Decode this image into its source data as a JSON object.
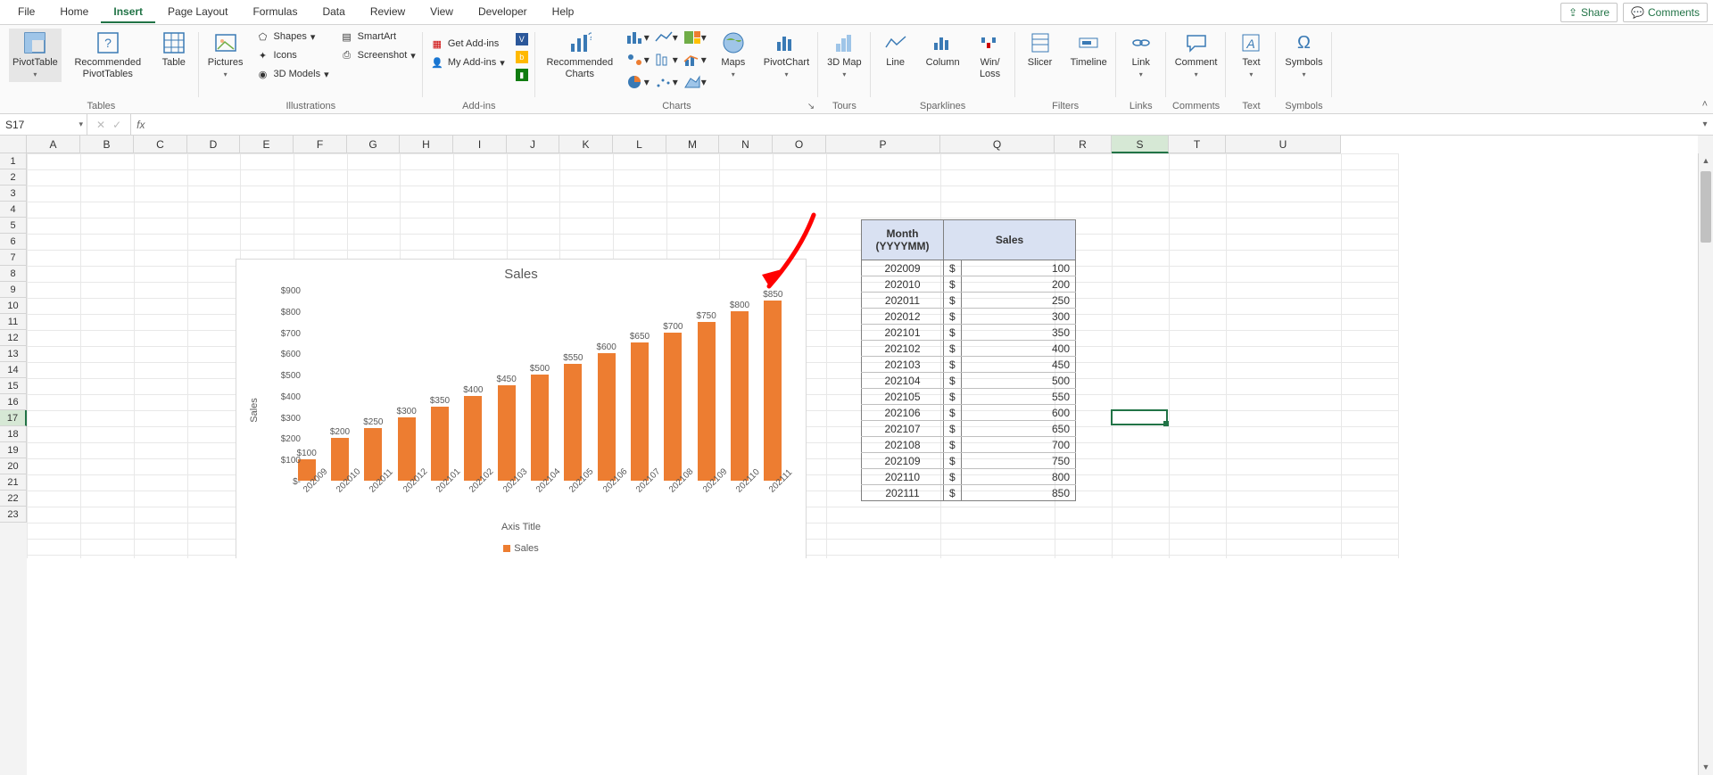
{
  "menubar": {
    "tabs": [
      "File",
      "Home",
      "Insert",
      "Page Layout",
      "Formulas",
      "Data",
      "Review",
      "View",
      "Developer",
      "Help"
    ],
    "active_index": 2,
    "share": "Share",
    "comments": "Comments"
  },
  "ribbon": {
    "groups": {
      "tables": {
        "label": "Tables",
        "pivot": "PivotTable",
        "recpivot": "Recommended PivotTables",
        "table": "Table"
      },
      "illustrations": {
        "label": "Illustrations",
        "pictures": "Pictures",
        "shapes": "Shapes",
        "icons": "Icons",
        "models": "3D Models",
        "smartart": "SmartArt",
        "screenshot": "Screenshot"
      },
      "addins": {
        "label": "Add-ins",
        "get": "Get Add-ins",
        "my": "My Add-ins"
      },
      "charts": {
        "label": "Charts",
        "rec": "Recommended Charts",
        "maps": "Maps",
        "pivotchart": "PivotChart"
      },
      "tours": {
        "label": "Tours",
        "map3d": "3D Map"
      },
      "sparklines": {
        "label": "Sparklines",
        "line": "Line",
        "column": "Column",
        "winloss": "Win/\nLoss"
      },
      "filters": {
        "label": "Filters",
        "slicer": "Slicer",
        "timeline": "Timeline"
      },
      "links": {
        "label": "Links",
        "link": "Link"
      },
      "comments": {
        "label": "Comments",
        "comment": "Comment"
      },
      "text": {
        "label": "Text",
        "text": "Text"
      },
      "symbols": {
        "label": "Symbols",
        "symbols": "Symbols"
      }
    }
  },
  "formula_bar": {
    "name_box": "S17",
    "fx_value": ""
  },
  "columns": [
    "A",
    "B",
    "C",
    "D",
    "E",
    "F",
    "G",
    "H",
    "I",
    "J",
    "K",
    "L",
    "M",
    "N",
    "O",
    "P",
    "Q",
    "R",
    "S",
    "T",
    "U"
  ],
  "selected_col": "S",
  "row_count": 23,
  "selected_row": 17,
  "col_boundaries": [
    0,
    60,
    120,
    180,
    239,
    299,
    359,
    418,
    478,
    538,
    597,
    657,
    717,
    776,
    836,
    896,
    1024,
    1152,
    1216,
    1280,
    1344,
    1473,
    1537
  ],
  "chart_data": {
    "type": "bar",
    "title": "Sales",
    "ylabel": "Sales",
    "xaxis_title": "Axis Title",
    "legend": "Sales",
    "categories": [
      "202009",
      "202010",
      "202011",
      "202012",
      "202101",
      "202102",
      "202103",
      "202104",
      "202105",
      "202106",
      "202107",
      "202108",
      "202109",
      "202110",
      "202111"
    ],
    "values": [
      100,
      200,
      250,
      300,
      350,
      400,
      450,
      500,
      550,
      600,
      650,
      700,
      750,
      800,
      850
    ],
    "data_labels": [
      "$100",
      "$200",
      "$250",
      "$300",
      "$350",
      "$400",
      "$450",
      "$500",
      "$550",
      "$600",
      "$650",
      "$700",
      "$750",
      "$800",
      "$850"
    ],
    "yticks": [
      "$-",
      "$100",
      "$200",
      "$300",
      "$400",
      "$500",
      "$600",
      "$700",
      "$800",
      "$900"
    ],
    "ylim": [
      0,
      900
    ]
  },
  "table": {
    "headers": [
      "Month (YYYYMM)",
      "Sales"
    ],
    "currency": "$",
    "rows": [
      {
        "month": "202009",
        "value": "100"
      },
      {
        "month": "202010",
        "value": "200"
      },
      {
        "month": "202011",
        "value": "250"
      },
      {
        "month": "202012",
        "value": "300"
      },
      {
        "month": "202101",
        "value": "350"
      },
      {
        "month": "202102",
        "value": "400"
      },
      {
        "month": "202103",
        "value": "450"
      },
      {
        "month": "202104",
        "value": "500"
      },
      {
        "month": "202105",
        "value": "550"
      },
      {
        "month": "202106",
        "value": "600"
      },
      {
        "month": "202107",
        "value": "650"
      },
      {
        "month": "202108",
        "value": "700"
      },
      {
        "month": "202109",
        "value": "750"
      },
      {
        "month": "202110",
        "value": "800"
      },
      {
        "month": "202111",
        "value": "850"
      }
    ]
  }
}
